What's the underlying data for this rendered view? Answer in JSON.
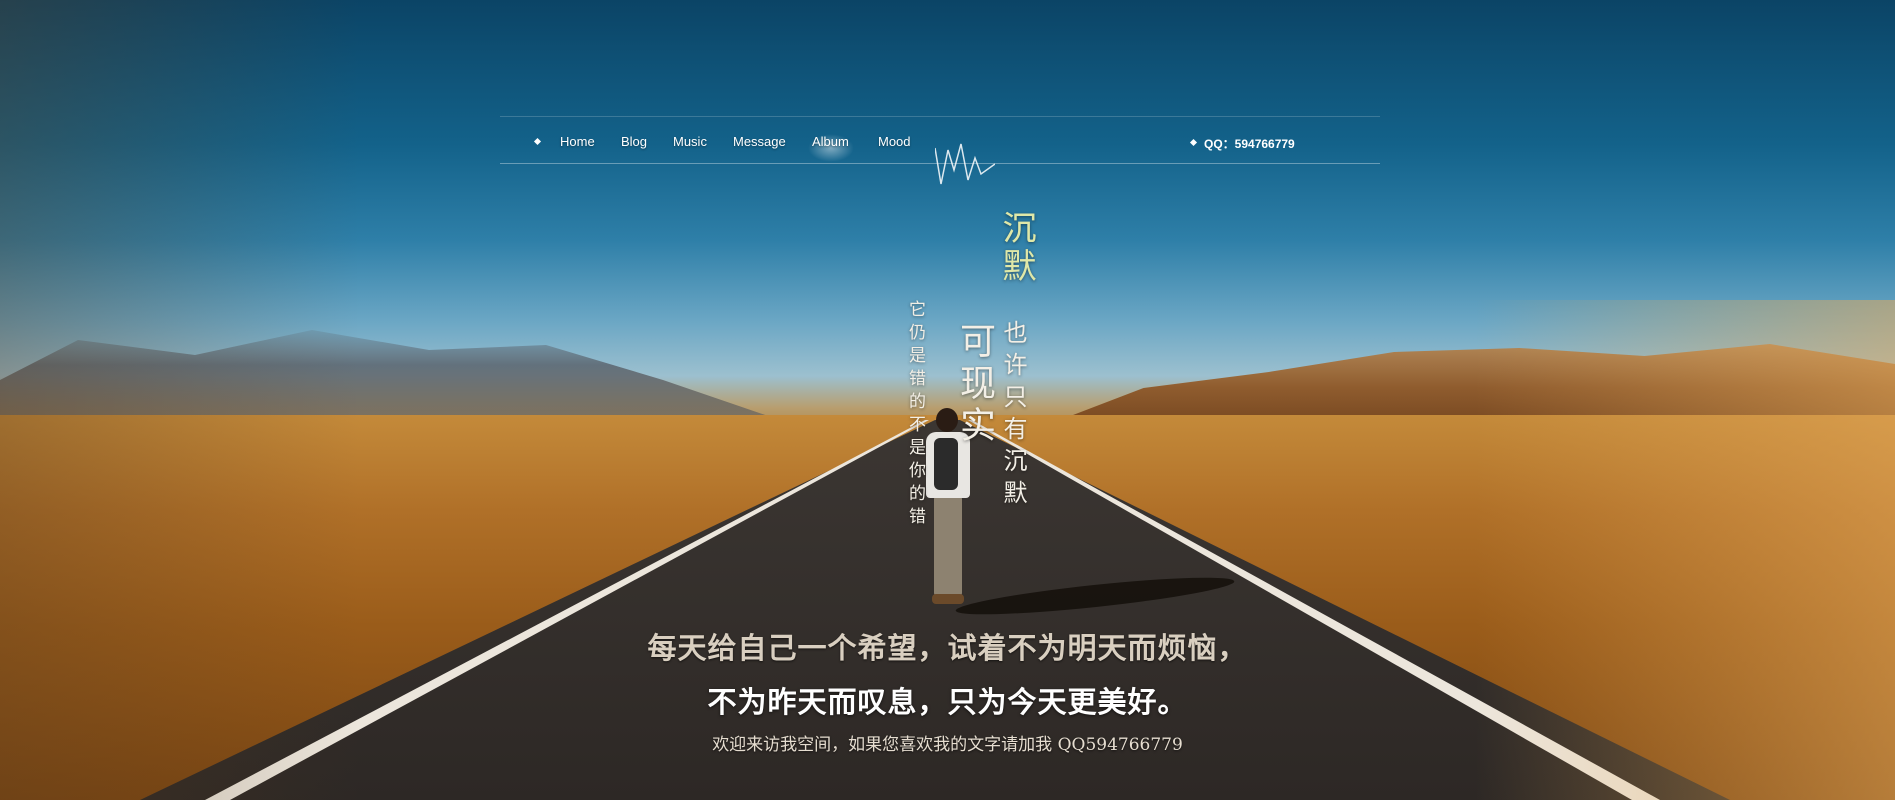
{
  "nav": {
    "items": [
      {
        "label": "Home"
      },
      {
        "label": "Blog"
      },
      {
        "label": "Music"
      },
      {
        "label": "Message"
      },
      {
        "label": "Album",
        "active": true
      },
      {
        "label": "Mood"
      }
    ],
    "qq_label": "QQ：594766779"
  },
  "hero": {
    "vertical_text": {
      "line1": "沉默",
      "line2": "也许只有沉默",
      "line3": "可现实",
      "line4": "它仍是错的不是你的错"
    },
    "tagline_1": "每天给自己一个希望，试着不为明天而烦恼，",
    "tagline_2": "不为昨天而叹息，只为今天更美好。",
    "welcome": "欢迎来访我空间，如果您喜欢我的文字请加我 QQ594766779"
  },
  "colors": {
    "sky_top": "#0b4466",
    "sky_mid": "#2e7fa8",
    "desert": "#b07028",
    "accent_text": "#dfe8a8"
  }
}
